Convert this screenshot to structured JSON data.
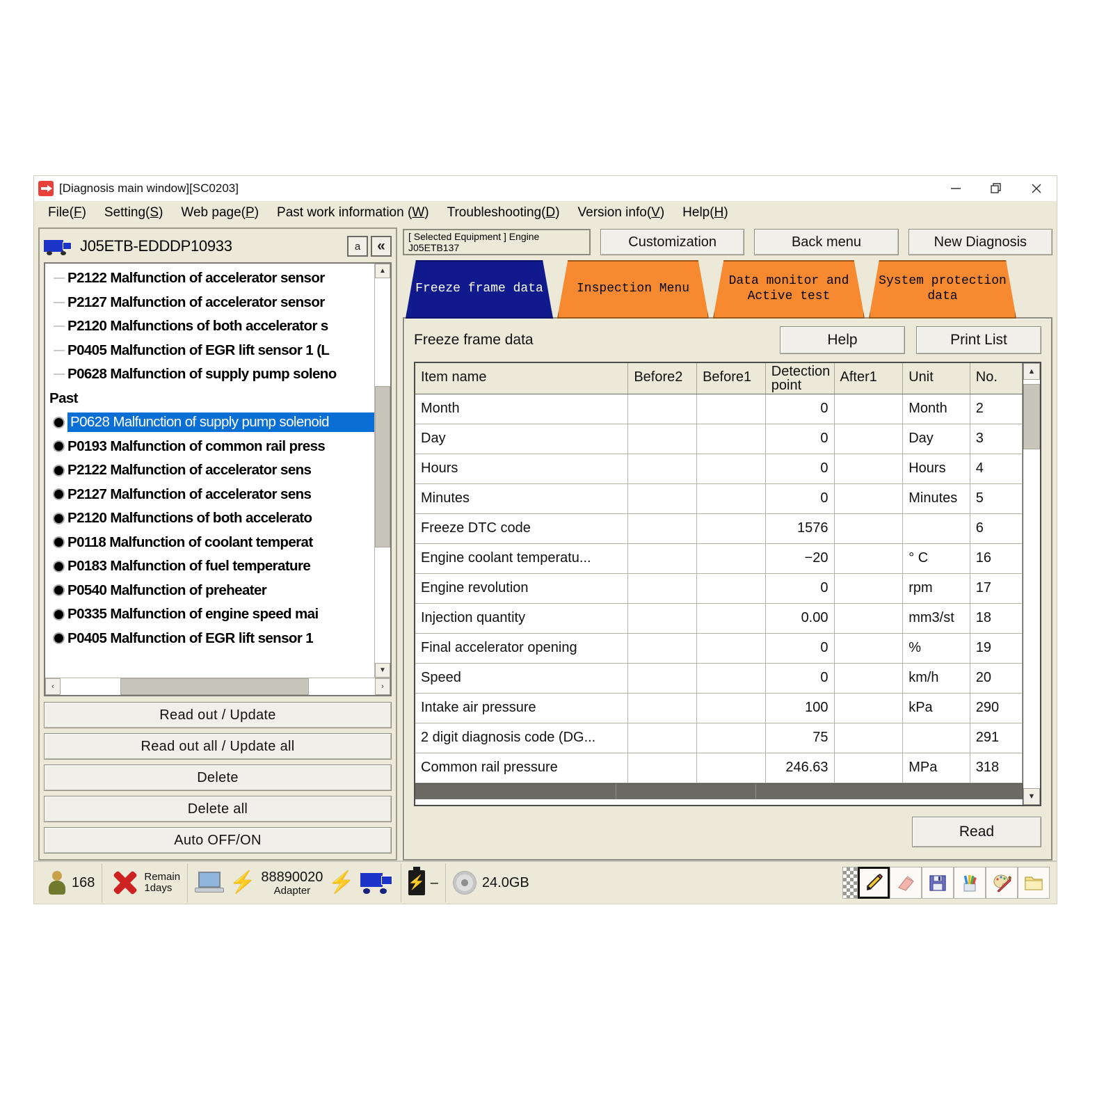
{
  "window": {
    "title": "[Diagnosis main window][SC0203]",
    "app_icon": "diagnosis-app-icon",
    "minimize_label": "–",
    "restore_label": "❐",
    "close_label": "✕"
  },
  "menu": [
    {
      "text": "File",
      "key": "F"
    },
    {
      "text": "Setting",
      "key": "S"
    },
    {
      "text": "Web page",
      "key": "P"
    },
    {
      "text": "Past work information ",
      "key": "W"
    },
    {
      "text": "Troubleshooting",
      "key": "D"
    },
    {
      "text": "Version info",
      "key": "V"
    },
    {
      "text": "Help",
      "key": "H"
    }
  ],
  "left_panel": {
    "equipment_id": "J05ETB-EDDDP10933",
    "btn_a": "a",
    "btn_collapse": "«",
    "scroll_up": "▲",
    "scroll_down": "▼",
    "scroll_left": "‹",
    "scroll_right": "›",
    "tree": [
      {
        "kind": "item",
        "text": "P2122 Malfunction of accelerator sensor"
      },
      {
        "kind": "item",
        "text": "P2127 Malfunction of accelerator sensor"
      },
      {
        "kind": "item",
        "text": "P2120 Malfunctions of both accelerator s"
      },
      {
        "kind": "item",
        "text": "P0405 Malfunction of EGR lift sensor 1 (L"
      },
      {
        "kind": "item",
        "text": "P0628 Malfunction of supply pump soleno"
      },
      {
        "kind": "group",
        "text": "Past"
      },
      {
        "kind": "past",
        "text": "P0628 Malfunction of supply pump solenoid",
        "selected": true
      },
      {
        "kind": "past",
        "text": "P0193 Malfunction of common rail press"
      },
      {
        "kind": "past",
        "text": "P2122 Malfunction of accelerator sens"
      },
      {
        "kind": "past",
        "text": "P2127 Malfunction of accelerator sens"
      },
      {
        "kind": "past",
        "text": "P2120 Malfunctions of both accelerato"
      },
      {
        "kind": "past",
        "text": "P0118 Malfunction of coolant temperat"
      },
      {
        "kind": "past",
        "text": "P0183 Malfunction of fuel temperature"
      },
      {
        "kind": "past",
        "text": "P0540 Malfunction of preheater"
      },
      {
        "kind": "past",
        "text": "P0335 Malfunction of engine speed mai"
      },
      {
        "kind": "past",
        "text": "P0405 Malfunction of EGR lift sensor 1 "
      }
    ],
    "buttons": [
      "Read out / Update",
      "Read out all / Update all",
      "Delete",
      "Delete all",
      "Auto OFF/ON"
    ]
  },
  "right_panel": {
    "selected_equipment_line1": "[ Selected Equipment ] Engine",
    "selected_equipment_line2": "J05ETB137",
    "top_buttons": [
      "Customization",
      "Back menu",
      "New Diagnosis"
    ],
    "tabs": [
      {
        "label": "Freeze frame data",
        "active": true
      },
      {
        "label": "Inspection Menu",
        "active": false
      },
      {
        "label": "Data monitor and\nActive test",
        "active": false
      },
      {
        "label": "System protection\ndata",
        "active": false
      }
    ],
    "card_title": "Freeze frame data",
    "help_button": "Help",
    "print_list_button": "Print List",
    "read_button": "Read",
    "scroll_up": "▲",
    "scroll_down": "▼"
  },
  "table": {
    "headers": [
      "Item name",
      "Before2",
      "Before1",
      "Detection point",
      "After1",
      "Unit",
      "No."
    ],
    "rows": [
      {
        "item": "Month",
        "before2": "",
        "before1": "",
        "detection": "0",
        "after1": "",
        "unit": "Month",
        "no": "2"
      },
      {
        "item": "Day",
        "before2": "",
        "before1": "",
        "detection": "0",
        "after1": "",
        "unit": "Day",
        "no": "3"
      },
      {
        "item": "Hours",
        "before2": "",
        "before1": "",
        "detection": "0",
        "after1": "",
        "unit": "Hours",
        "no": "4"
      },
      {
        "item": "Minutes",
        "before2": "",
        "before1": "",
        "detection": "0",
        "after1": "",
        "unit": "Minutes",
        "no": "5"
      },
      {
        "item": "Freeze DTC code",
        "before2": "",
        "before1": "",
        "detection": "1576",
        "after1": "",
        "unit": "",
        "no": "6"
      },
      {
        "item": "Engine coolant temperatu...",
        "before2": "",
        "before1": "",
        "detection": "−20",
        "after1": "",
        "unit": "° C",
        "no": "16"
      },
      {
        "item": "Engine revolution",
        "before2": "",
        "before1": "",
        "detection": "0",
        "after1": "",
        "unit": "rpm",
        "no": "17"
      },
      {
        "item": "Injection quantity",
        "before2": "",
        "before1": "",
        "detection": "0.00",
        "after1": "",
        "unit": "mm3/st",
        "no": "18"
      },
      {
        "item": "Final accelerator opening",
        "before2": "",
        "before1": "",
        "detection": "0",
        "after1": "",
        "unit": "%",
        "no": "19"
      },
      {
        "item": "Speed",
        "before2": "",
        "before1": "",
        "detection": "0",
        "after1": "",
        "unit": "km/h",
        "no": "20"
      },
      {
        "item": "Intake air pressure",
        "before2": "",
        "before1": "",
        "detection": "100",
        "after1": "",
        "unit": "kPa",
        "no": "290"
      },
      {
        "item": "2 digit diagnosis code (DG...",
        "before2": "",
        "before1": "",
        "detection": "75",
        "after1": "",
        "unit": "",
        "no": "291"
      },
      {
        "item": "Common rail pressure",
        "before2": "",
        "before1": "",
        "detection": "246.63",
        "after1": "",
        "unit": "MPa",
        "no": "318"
      }
    ]
  },
  "statusbar": {
    "user_count": "168",
    "remain_line1": "Remain",
    "remain_line2": "1days",
    "adapter_number": "88890020",
    "adapter_label": "Adapter",
    "battery_value": "–",
    "disk_value": "24.0GB",
    "tools": [
      {
        "name": "pencil-icon",
        "selected": true
      },
      {
        "name": "eraser-icon",
        "selected": false
      },
      {
        "name": "save-icon",
        "selected": false
      },
      {
        "name": "markers-icon",
        "selected": false
      },
      {
        "name": "palette-icon",
        "selected": false
      },
      {
        "name": "folder-icon",
        "selected": false
      }
    ]
  },
  "colors": {
    "tab_active": "#101a8c",
    "tab_inactive": "#f78a31",
    "selection": "#0a6fd4",
    "window_bg": "#ece9d8"
  }
}
